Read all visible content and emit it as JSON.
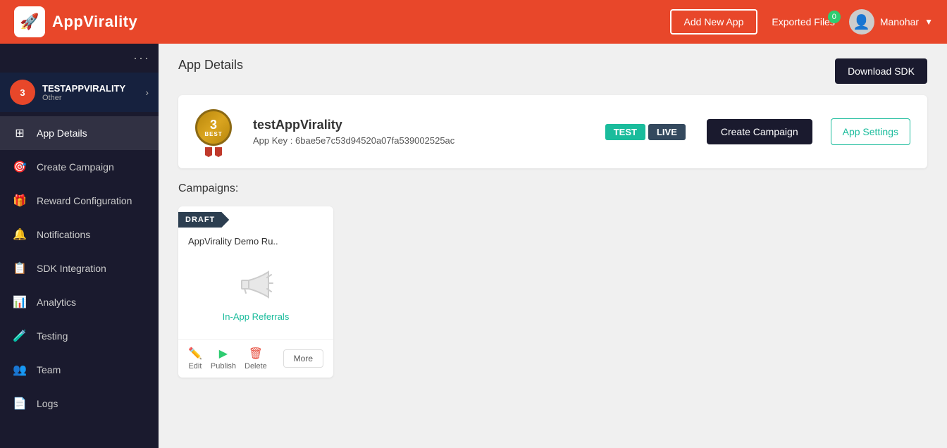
{
  "header": {
    "logo_text": "AppVirality",
    "logo_icon": "🚀",
    "add_new_app_label": "Add New App",
    "exported_files_label": "Exported Files",
    "exported_files_badge": "0",
    "username": "Manohar"
  },
  "sidebar": {
    "dots": "···",
    "app": {
      "badge_number": "3",
      "name": "TESTAPPVIRALITY",
      "category": "Other"
    },
    "nav_items": [
      {
        "id": "app-details",
        "label": "App Details",
        "icon": "⊞",
        "active": true
      },
      {
        "id": "create-campaign",
        "label": "Create Campaign",
        "icon": "🎯"
      },
      {
        "id": "reward-configuration",
        "label": "Reward Configuration",
        "icon": "🎁"
      },
      {
        "id": "notifications",
        "label": "Notifications",
        "icon": "🔔"
      },
      {
        "id": "sdk-integration",
        "label": "SDK Integration",
        "icon": "📋"
      },
      {
        "id": "analytics",
        "label": "Analytics",
        "icon": "📊"
      },
      {
        "id": "testing",
        "label": "Testing",
        "icon": "🧪"
      },
      {
        "id": "team",
        "label": "Team",
        "icon": "👥"
      },
      {
        "id": "logs",
        "label": "Logs",
        "icon": "📄"
      }
    ]
  },
  "content": {
    "page_title": "App Details",
    "download_sdk_label": "Download SDK",
    "app_card": {
      "badge_number": "3",
      "badge_label": "BEST",
      "app_name": "testAppVirality",
      "app_key_label": "App Key :",
      "app_key_value": "6bae5e7c53d94520a07fa539002525ac",
      "test_label": "TEST",
      "live_label": "LIVE",
      "create_campaign_label": "Create Campaign",
      "app_settings_label": "App Settings"
    },
    "campaigns_title": "Campaigns:",
    "campaigns": [
      {
        "id": "campaign-1",
        "status": "DRAFT",
        "name": "AppVirality Demo Ru..",
        "type": "In-App Referrals",
        "actions": {
          "edit": "Edit",
          "publish": "Publish",
          "delete": "Delete",
          "more": "More"
        }
      }
    ]
  },
  "colors": {
    "header_bg": "#e8472a",
    "sidebar_bg": "#1a1a2e",
    "sidebar_active": "rgba(255,255,255,0.1)",
    "teal": "#1abc9c",
    "dark_navy": "#1a1a2e"
  }
}
